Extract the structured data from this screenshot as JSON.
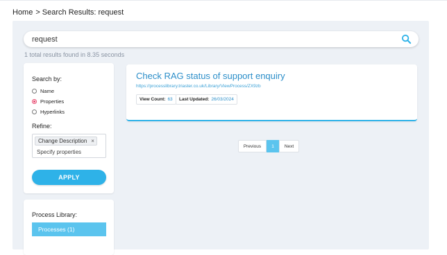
{
  "breadcrumb": {
    "home": "Home",
    "separator": ">",
    "current": "Search Results: request"
  },
  "search": {
    "value": "request",
    "placeholder": "",
    "icon": "search-icon"
  },
  "results_summary": "1 total results found in 8.35 seconds",
  "filters": {
    "search_by_label": "Search by:",
    "options": [
      {
        "label": "Name",
        "checked": false
      },
      {
        "label": "Properties",
        "checked": true
      },
      {
        "label": "Hyperlinks",
        "checked": false
      }
    ],
    "refine_label": "Refine:",
    "tag": "Change Description",
    "tag_remove": "×",
    "properties_placeholder": "Specify properties",
    "apply_label": "APPLY"
  },
  "library": {
    "heading": "Process Library:",
    "processes_label": "Processes (1)"
  },
  "results": [
    {
      "title": "Check RAG status of support enquiry",
      "url": "https://processlibrary.triaster.co.uk/Library/ViewProcess/ZX9zb",
      "view_count_label": "View Count:",
      "view_count": "63",
      "last_updated_label": "Last Updated:",
      "last_updated": "26/03/2024"
    }
  ],
  "pagination": {
    "previous": "Previous",
    "current_page": "1",
    "next": "Next"
  },
  "colors": {
    "accent": "#2eb2e8",
    "link": "#2b8ec9",
    "panel_bg": "#edf1f6",
    "radio_selected": "#e8456c"
  }
}
